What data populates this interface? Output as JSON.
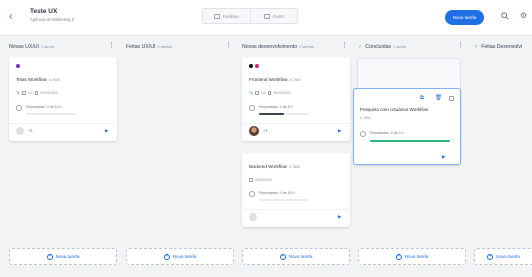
{
  "header": {
    "back_icon": "chevron-left-icon",
    "title": "Teste UX",
    "subtitle": "Agência de Marketing 2",
    "views": [
      {
        "label": "Kanban",
        "icon": "kanban-icon"
      },
      {
        "label": "Gantt",
        "icon": "gantt-icon"
      }
    ],
    "new_task_label": "Nova tarefa",
    "search_icon": "search-icon",
    "settings_icon": "gear-icon",
    "accent": "#1f6fe5"
  },
  "columns": [
    {
      "title": "Novas UX/UI",
      "count": "1 tarefa",
      "done": false
    },
    {
      "title": "Feitas UX/UI",
      "count": "0 tarefas",
      "done": false
    },
    {
      "title": "Novas desenvolvimento",
      "count": "2 tarefas",
      "done": false
    },
    {
      "title": "Concluídas",
      "count": "1 tarefa",
      "done": true
    },
    {
      "title": "Feitas Desenvolvi",
      "count": "",
      "done": true
    }
  ],
  "cards": {
    "telas": {
      "title": "Telas Workflow",
      "id": "# 7848",
      "tag_colors": [
        "#7a2fc4"
      ],
      "attachments": "",
      "subtasks": "0/4",
      "date": "30/04/2020",
      "reported": "Reportadas: 0 de 16 h",
      "progress": 0,
      "assignees": "+1"
    },
    "frontend": {
      "title": "Frontend Workflow",
      "id": "# 7849",
      "tag_colors": [
        "#111111",
        "#d6247a"
      ],
      "attachments": "",
      "subtasks": "0/4",
      "date": "30/04/2020",
      "reported": "Reportadas: 4 de 8 h",
      "progress": 0.5,
      "assignees": "+1"
    },
    "backend": {
      "title": "Backend Workflow",
      "id": "# 7850",
      "date": "30/04/2020",
      "reported": "Reportadas: 0 de 16 h",
      "progress": 0
    },
    "pesquisa": {
      "title": "Pesquisa com Usuários Workflow",
      "id": "# 7851",
      "reported": "Reportadas: 4 de 4 h",
      "progress": 1,
      "progress_color": "#2eb67d"
    }
  },
  "add_task_label": "Nova tarefa"
}
